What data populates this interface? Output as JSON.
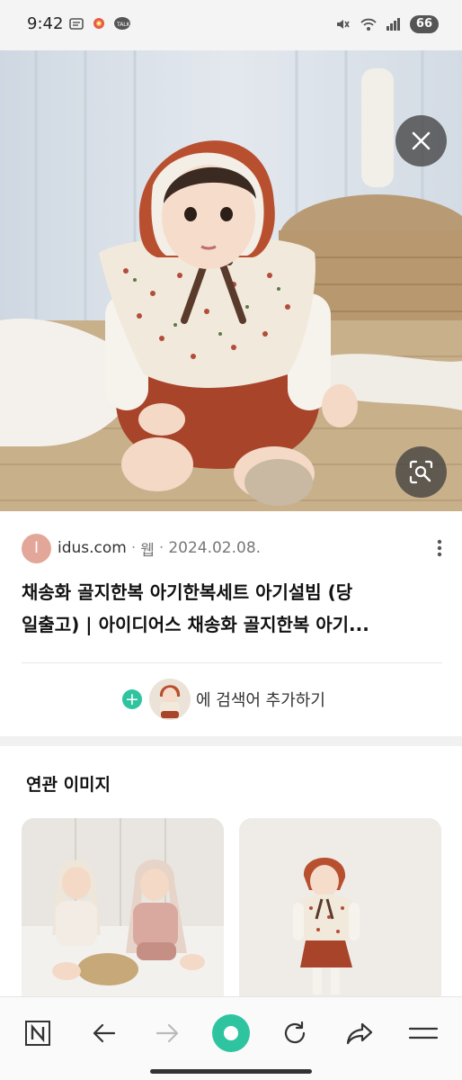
{
  "status_bar": {
    "time": "9:42",
    "battery_level": "66",
    "icons": [
      "message-icon",
      "photos-icon",
      "kakaotalk-icon",
      "mute-icon",
      "wifi-icon",
      "signal-icon"
    ]
  },
  "image_viewer": {
    "close_icon": "close-icon",
    "lens_icon": "image-search-icon"
  },
  "result": {
    "source_initial": "I",
    "source_domain": "idus.com",
    "source_type": "웹",
    "date": "2024.02.08.",
    "title_line1": "채송화 골지한복 아기한복세트 아기설빔 (당",
    "title_line2": "일출고) | 아이디어스 채송화 골지한복 아기..."
  },
  "add_search": {
    "label": "에 검색어 추가하기"
  },
  "related": {
    "title": "연관 이미지"
  },
  "bottom_nav": {
    "items": [
      "naver-home-icon",
      "back-icon",
      "forward-icon",
      "green-dot-icon",
      "refresh-icon",
      "share-icon",
      "menu-icon"
    ]
  },
  "colors": {
    "accent_green": "#2fc4a0",
    "source_avatar": "#e3a79a",
    "hat_red": "#b8502f"
  }
}
